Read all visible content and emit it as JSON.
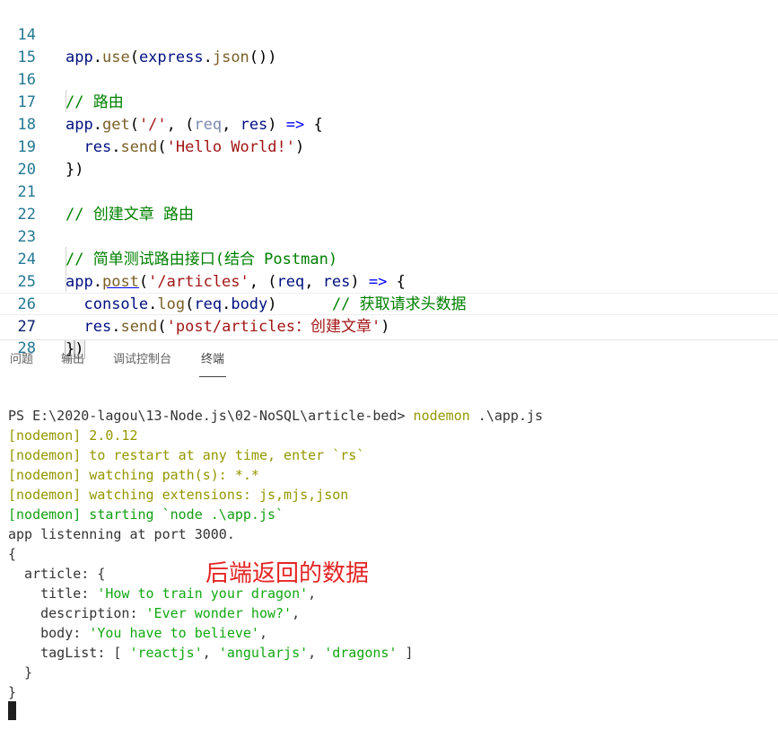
{
  "editor": {
    "lines": [
      {
        "num": "14",
        "text": "app.use(express.json())"
      },
      {
        "num": "15",
        "text": ""
      },
      {
        "num": "16",
        "text": "// 路由"
      },
      {
        "num": "17",
        "text": "app.get('/', (req, res) => {"
      },
      {
        "num": "18",
        "text": "  res.send('Hello World!')"
      },
      {
        "num": "19",
        "text": "})"
      },
      {
        "num": "20",
        "text": ""
      },
      {
        "num": "21",
        "text": "// 创建文章 路由"
      },
      {
        "num": "22",
        "text": ""
      },
      {
        "num": "23",
        "text": "// 简单测试路由接口(结合 Postman)"
      },
      {
        "num": "24",
        "text": "app.post('/articles', (req, res) => {"
      },
      {
        "num": "25",
        "text": "  console.log(req.body)      // 获取请求头数据"
      },
      {
        "num": "26",
        "text": "  res.send('post/articles：创建文章')"
      },
      {
        "num": "27",
        "text": "})"
      },
      {
        "num": "28",
        "text": ""
      }
    ]
  },
  "panel": {
    "tabs": [
      "问题",
      "输出",
      "调试控制台",
      "终端"
    ],
    "active_tab": "终端"
  },
  "terminal": {
    "prompt": "PS E:\\2020-lagou\\13-Node.js\\02-NoSQL\\article-bed> ",
    "command": "nodemon",
    "command_args": " .\\app.js",
    "nodemon_lines": [
      {
        "tag": "[nodemon]",
        "msg": " 2.0.12",
        "color": "yellow"
      },
      {
        "tag": "[nodemon]",
        "msg": " to restart at any time, enter `rs`",
        "color": "yellow"
      },
      {
        "tag": "[nodemon]",
        "msg": " watching path(s): *.*",
        "color": "yellow"
      },
      {
        "tag": "[nodemon]",
        "msg": " watching extensions: js,mjs,json",
        "color": "yellow"
      },
      {
        "tag": "[nodemon]",
        "msg": " starting `node .\\app.js`",
        "color": "green"
      }
    ],
    "listen_line": "app listenning at port 3000.",
    "output": {
      "open_brace": "{",
      "article_key": "  article: {",
      "title_key": "    title: ",
      "title_val": "'How to train your dragon'",
      "description_key": "    description: ",
      "description_val": "'Ever wonder how?'",
      "body_key": "    body: ",
      "body_val": "'You have to believe'",
      "taglist_key": "    tagList: [ ",
      "tag1": "'reactjs'",
      "tag2": "'angularjs'",
      "tag3": "'dragons'",
      "inner_close": "  }",
      "close_brace": "}"
    }
  },
  "annotation": "后端返回的数据",
  "colors": {
    "annotation": "#e62424",
    "nodemon_yellow": "#949800",
    "nodemon_green": "#12a012",
    "string_green": "#11a811",
    "comment": "#008000",
    "string": "#a31515",
    "line_number": "#237893"
  }
}
